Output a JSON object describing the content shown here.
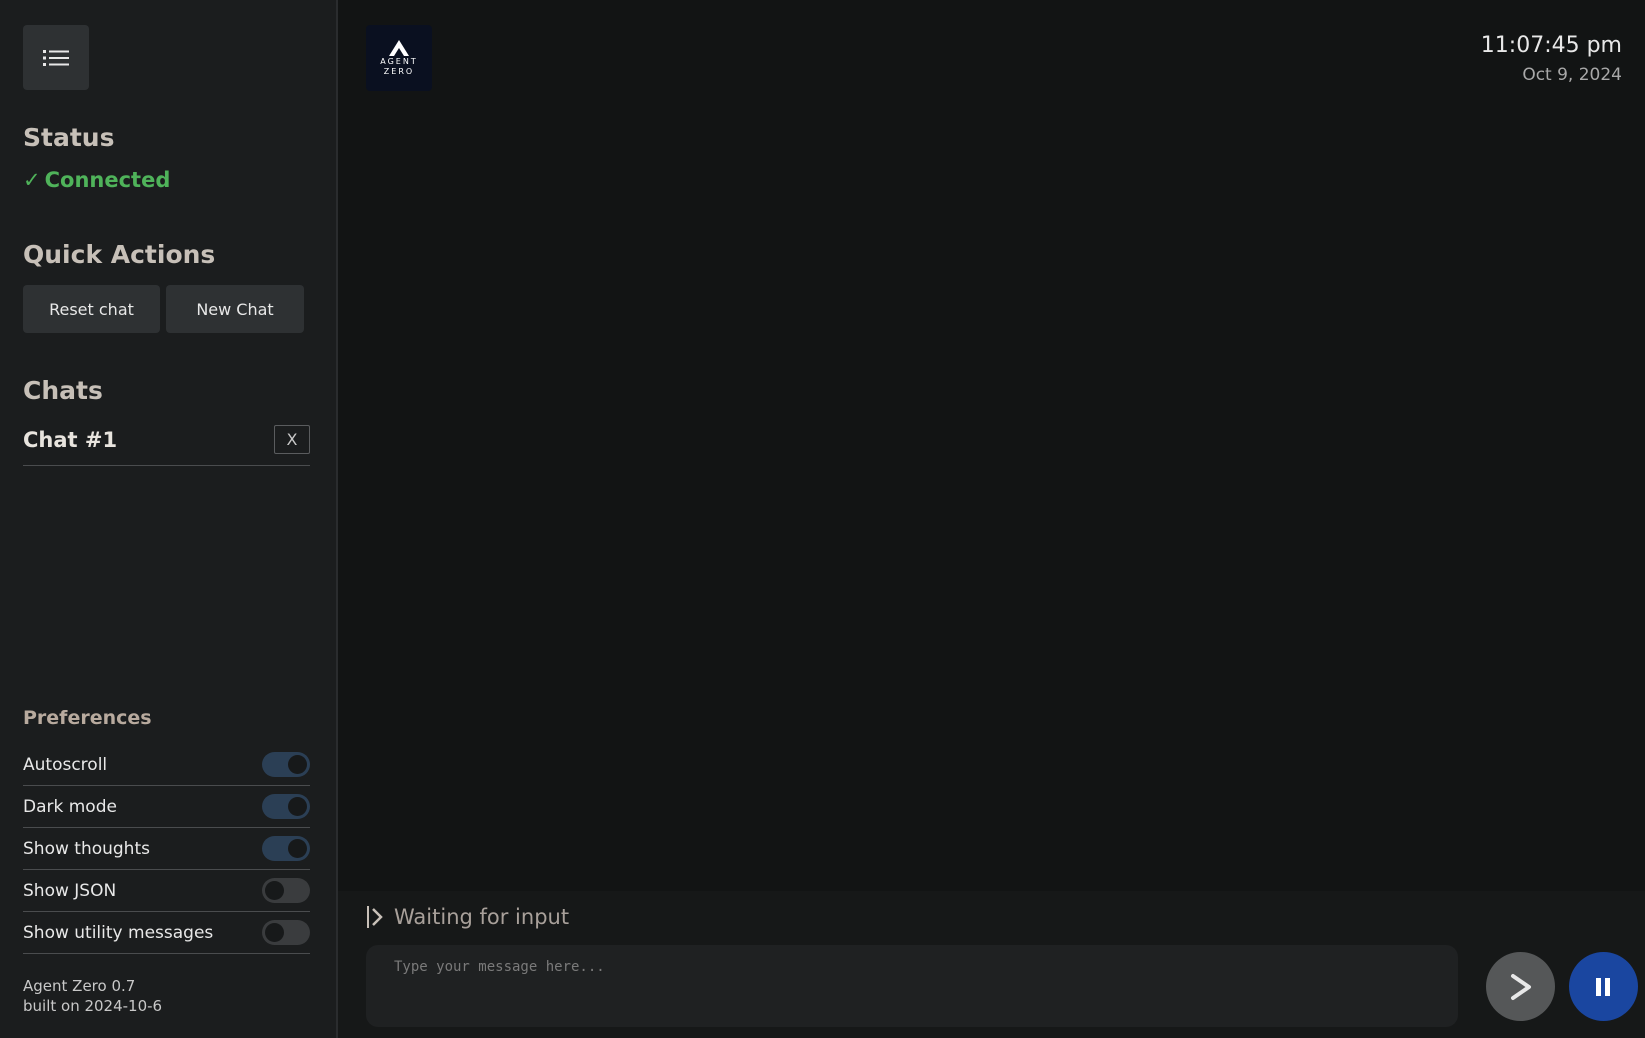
{
  "sidebar": {
    "menu_icon": "list-icon",
    "status": {
      "title": "Status",
      "check": "✓",
      "value": "Connected",
      "color": "#4fb35a"
    },
    "quick_actions": {
      "title": "Quick Actions",
      "reset_label": "Reset chat",
      "new_label": "New Chat"
    },
    "chats": {
      "title": "Chats",
      "items": [
        {
          "name": "Chat #1",
          "close_label": "X"
        }
      ]
    },
    "preferences": {
      "title": "Preferences",
      "items": [
        {
          "label": "Autoscroll",
          "enabled": true
        },
        {
          "label": "Dark mode",
          "enabled": true
        },
        {
          "label": "Show thoughts",
          "enabled": true
        },
        {
          "label": "Show JSON",
          "enabled": false
        },
        {
          "label": "Show utility messages",
          "enabled": false
        }
      ]
    },
    "version": {
      "name": "Agent Zero 0.7",
      "built": "built on 2024-10-6"
    }
  },
  "header": {
    "logo_line1": "AGENT",
    "logo_line2": "ZERO",
    "time": "11:07:45 pm",
    "date": "Oct 9, 2024"
  },
  "input": {
    "progress_text": "Waiting for input",
    "placeholder": "Type your message here...",
    "send_icon": "send-icon",
    "pause_icon": "pause-icon"
  },
  "colors": {
    "accent_blue": "#1a46a0",
    "status_green": "#4fb35a",
    "toggle_on": "#2b3f55"
  }
}
